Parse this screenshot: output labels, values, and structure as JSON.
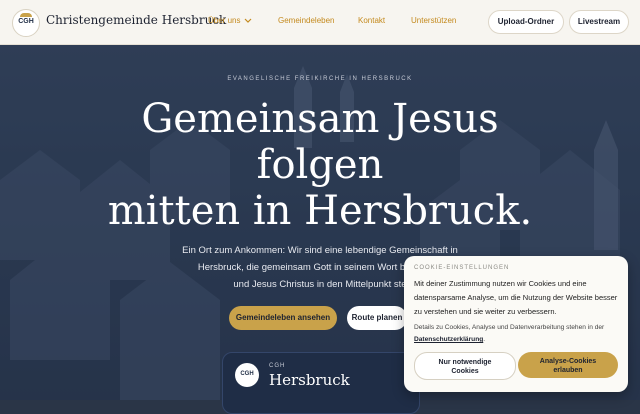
{
  "nav": {
    "logo_text": "CGH",
    "brand": "Christengemeinde Hersbruck",
    "items": [
      {
        "label": "Über uns"
      },
      {
        "label": "Gemeindeleben"
      },
      {
        "label": "Kontakt"
      },
      {
        "label": "Unterstützen"
      }
    ],
    "upload_label": "Upload-Ordner",
    "livestream_label": "Livestream",
    "accent": "#c48a1e"
  },
  "hero": {
    "eyebrow": "EVANGELISCHE FREIKIRCHE IN HERSBRUCK",
    "headline_lines": [
      "Gemeinsam Jesus",
      "folgen",
      "mitten in Hersbruck."
    ],
    "intro_lines": [
      "Ein Ort zum Ankommen: Wir sind eine lebendige Gemeinschaft in",
      "Hersbruck, die gemeinsam Gott in seinem Wort begegnen",
      "und Jesus Christus in den Mittelpunkt ste"
    ],
    "cta_primary": "Gemeindeleben ansehen",
    "cta_secondary": "Route planen"
  },
  "card": {
    "logo_text": "CGH",
    "kicker": "CGH",
    "title": "Hersbruck"
  },
  "cookie": {
    "title": "COOKIE-EINSTELLUNGEN",
    "text": "Mit deiner Zustimmung nutzen wir Cookies und eine datensparsame Analyse, um die Nutzung der Website besser zu verstehen und sie weiter zu verbessern.",
    "detail": "Details zu Cookies, Analyse und Datenverarbeitung stehen in der",
    "link": "Datenschutzerklärung",
    "link_suffix": ".",
    "btn_necessary_lines": [
      "Nur notwendige",
      "Cookies"
    ],
    "btn_accept_lines": [
      "Analyse-Cookies",
      "erlauben"
    ]
  },
  "colors": {
    "gold": "#c9a24a",
    "navy": "#1f2d46"
  }
}
